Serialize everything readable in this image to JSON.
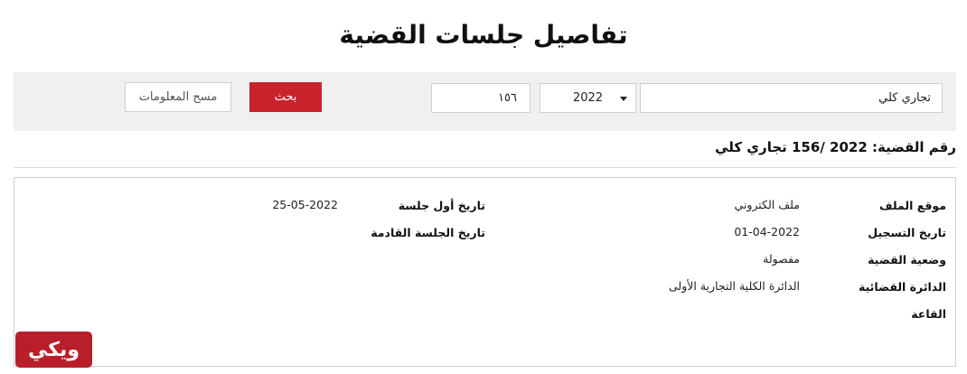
{
  "page": {
    "title": "تفاصيل جلسات القضية"
  },
  "search": {
    "case_type": "تجاري كلي",
    "year": "2022",
    "case_number": "١٥٦",
    "search_label": "بحث",
    "clear_label": "مسح المعلومات"
  },
  "case": {
    "heading": "رقم القضية: 2022 /156 تجاري كلي",
    "details": {
      "file_location_label": "موقع الملف",
      "file_location_value": "ملف الكتروني",
      "registration_date_label": "تاريخ التسجيل",
      "registration_date_value": "01-04-2022",
      "case_status_label": "وضعية القضية",
      "case_status_value": "مفصولة",
      "circuit_label": "الدائرة القضائية",
      "circuit_value": "الدائرة الكلية التجارية الأولى",
      "hall_label": "القاعة",
      "first_session_label": "تاريخ أول جلسة",
      "first_session_value": "25-05-2022",
      "next_session_label": "تاريخ الجلسة القادمة"
    }
  },
  "logo": {
    "text": "ويكي",
    "color": "#b81f2a"
  },
  "colors": {
    "accent": "#c8232c",
    "panel": "#f0f0f0"
  }
}
